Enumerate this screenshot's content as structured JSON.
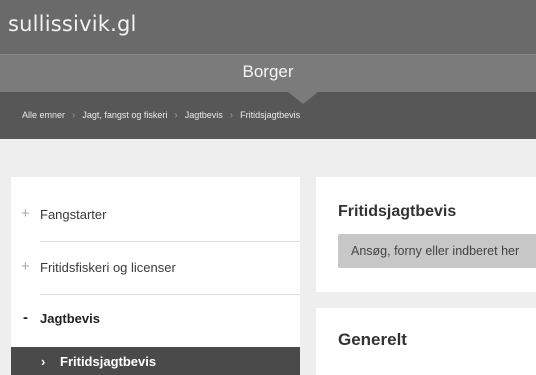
{
  "site": {
    "title": "sullissivik.gl"
  },
  "section": {
    "title": "Borger"
  },
  "breadcrumb": {
    "items": [
      "Alle emner",
      "Jagt, fangst og fiskeri",
      "Jagtbevis",
      "Fritidsjagtbevis"
    ],
    "separator": "›"
  },
  "sidebar": {
    "items": [
      {
        "symbol": "+",
        "label": "Fangstarter"
      },
      {
        "symbol": "+",
        "label": "Fritidsfiskeri og licenser"
      },
      {
        "symbol": "-",
        "label": "Jagtbevis"
      }
    ],
    "active_sub": {
      "symbol": "›",
      "label": "Fritidsjagtbevis"
    }
  },
  "main": {
    "page_title": "Fritidsjagtbevis",
    "apply_button": "Ansøg, forny eller indberet her",
    "section_heading": "Generelt"
  }
}
